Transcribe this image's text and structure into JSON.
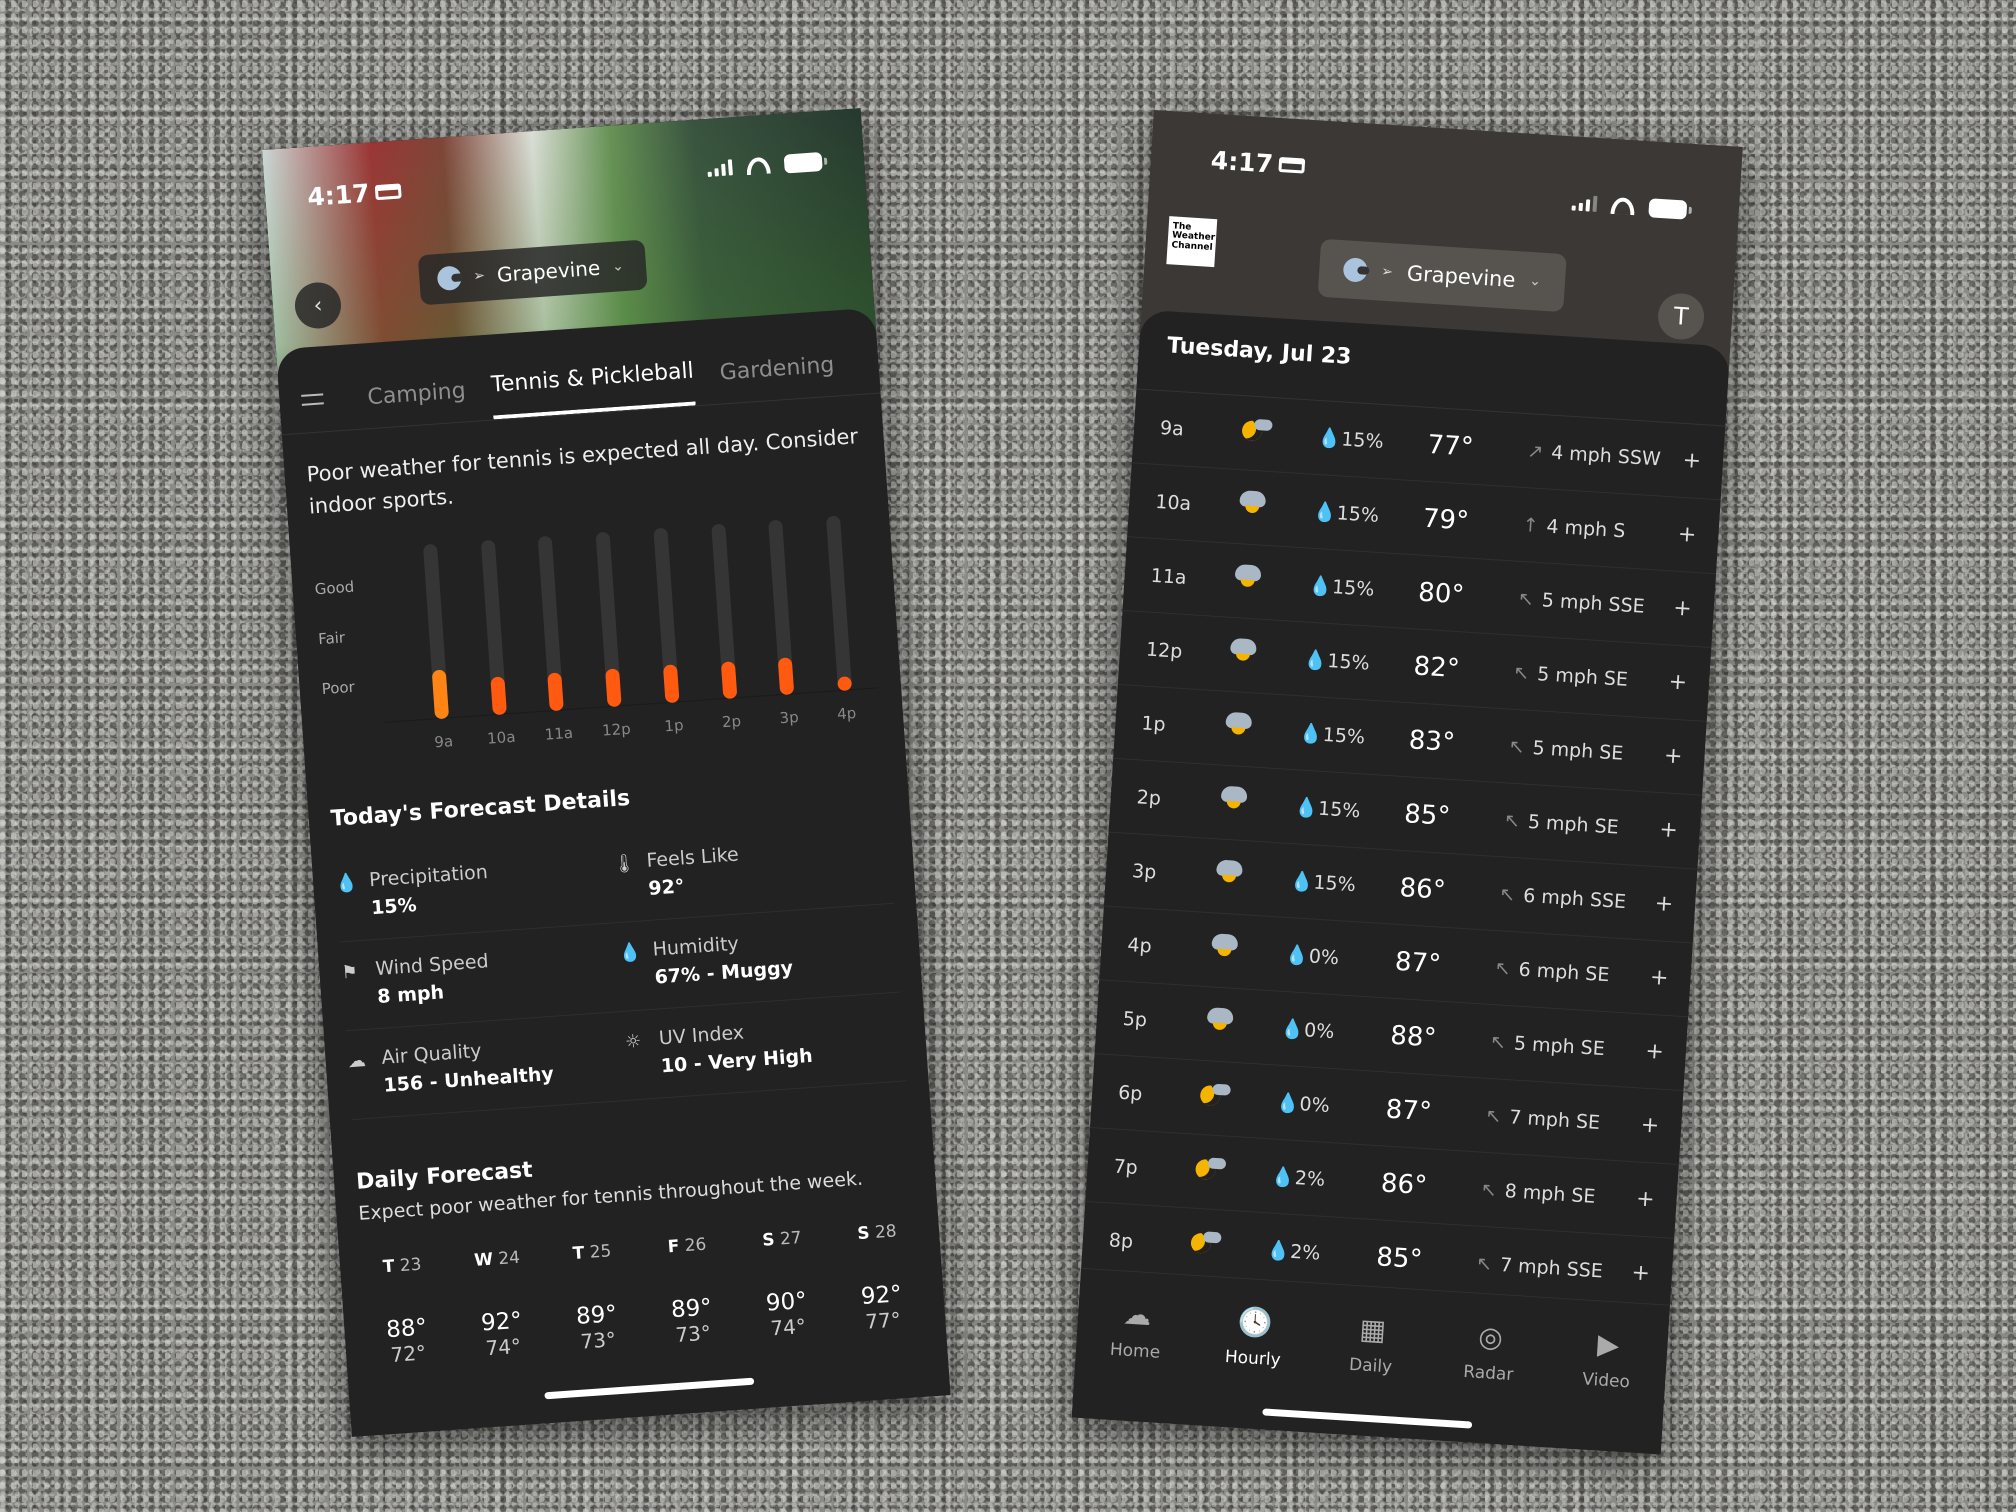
{
  "status_bar": {
    "time": "4:17"
  },
  "left_phone": {
    "location": "Grapevine",
    "tabs": [
      {
        "label": "Camping",
        "active": false
      },
      {
        "label": "Tennis & Pickleball",
        "active": true
      },
      {
        "label": "Gardening",
        "active": false
      }
    ],
    "summary": "Poor weather for tennis is expected all day. Consider indoor sports.",
    "activity_chart": {
      "y_levels": [
        "Good",
        "Fair",
        "Poor"
      ],
      "hours": [
        "9a",
        "10a",
        "11a",
        "12p",
        "1p",
        "2p",
        "3p",
        "4p"
      ],
      "scores": [
        0.28,
        0.22,
        0.22,
        0.22,
        0.22,
        0.21,
        0.21,
        0.05
      ],
      "fill_color": "#ff5a10"
    },
    "details_title": "Today's Forecast Details",
    "details": [
      {
        "icon": "droplet-icon",
        "glyph": "💧",
        "label": "Precipitation",
        "value": "15%"
      },
      {
        "icon": "thermometer-person-icon",
        "glyph": "🌡",
        "label": "Feels Like",
        "value": "92°"
      },
      {
        "icon": "wind-flag-icon",
        "glyph": "⚑",
        "label": "Wind Speed",
        "value": "8 mph"
      },
      {
        "icon": "humidity-drop-icon",
        "glyph": "💧",
        "label": "Humidity",
        "value": "67% - Muggy"
      },
      {
        "icon": "air-quality-icon",
        "glyph": "☁",
        "label": "Air Quality",
        "value": "156 - Unhealthy"
      },
      {
        "icon": "uv-sun-icon",
        "glyph": "☼",
        "label": "UV Index",
        "value": "10 - Very High"
      }
    ],
    "daily_title": "Daily Forecast",
    "daily_subtitle": "Expect poor weather for tennis throughout the week.",
    "daily": [
      {
        "dow": "T",
        "date": "23",
        "hi": "88°",
        "lo": "72°"
      },
      {
        "dow": "W",
        "date": "24",
        "hi": "92°",
        "lo": "74°"
      },
      {
        "dow": "T",
        "date": "25",
        "hi": "89°",
        "lo": "73°"
      },
      {
        "dow": "F",
        "date": "26",
        "hi": "89°",
        "lo": "73°"
      },
      {
        "dow": "S",
        "date": "27",
        "hi": "90°",
        "lo": "74°"
      },
      {
        "dow": "S",
        "date": "28",
        "hi": "92°",
        "lo": "77°"
      }
    ]
  },
  "right_phone": {
    "brand": "The Weather Channel",
    "location": "Grapevine",
    "avatar_initial": "T",
    "date_heading": "Tuesday, Jul 23",
    "hours": [
      {
        "time": "9a",
        "icon": "partly-cloudy-night",
        "precip": "15%",
        "temp": "77°",
        "wind_arrow": "↗",
        "wind": "4 mph SSW"
      },
      {
        "time": "10a",
        "icon": "mostly-cloudy",
        "precip": "15%",
        "temp": "79°",
        "wind_arrow": "↑",
        "wind": "4 mph S"
      },
      {
        "time": "11a",
        "icon": "mostly-cloudy",
        "precip": "15%",
        "temp": "80°",
        "wind_arrow": "↖",
        "wind": "5 mph SSE"
      },
      {
        "time": "12p",
        "icon": "mostly-cloudy",
        "precip": "15%",
        "temp": "82°",
        "wind_arrow": "↖",
        "wind": "5 mph SE"
      },
      {
        "time": "1p",
        "icon": "mostly-cloudy",
        "precip": "15%",
        "temp": "83°",
        "wind_arrow": "↖",
        "wind": "5 mph SE"
      },
      {
        "time": "2p",
        "icon": "mostly-cloudy",
        "precip": "15%",
        "temp": "85°",
        "wind_arrow": "↖",
        "wind": "5 mph SE"
      },
      {
        "time": "3p",
        "icon": "mostly-cloudy",
        "precip": "15%",
        "temp": "86°",
        "wind_arrow": "↖",
        "wind": "6 mph SSE"
      },
      {
        "time": "4p",
        "icon": "mostly-cloudy",
        "precip": "0%",
        "temp": "87°",
        "wind_arrow": "↖",
        "wind": "6 mph SE"
      },
      {
        "time": "5p",
        "icon": "mostly-cloudy",
        "precip": "0%",
        "temp": "88°",
        "wind_arrow": "↖",
        "wind": "5 mph SE"
      },
      {
        "time": "6p",
        "icon": "partly-cloudy-night",
        "precip": "0%",
        "temp": "87°",
        "wind_arrow": "↖",
        "wind": "7 mph SE"
      },
      {
        "time": "7p",
        "icon": "partly-cloudy-night",
        "precip": "2%",
        "temp": "86°",
        "wind_arrow": "↖",
        "wind": "8 mph SE"
      },
      {
        "time": "8p",
        "icon": "partly-cloudy-night",
        "precip": "2%",
        "temp": "85°",
        "wind_arrow": "↖",
        "wind": "7 mph SSE"
      }
    ],
    "tabbar": [
      {
        "label": "Home",
        "icon": "cloud-icon",
        "glyph": "☁",
        "active": false
      },
      {
        "label": "Hourly",
        "icon": "clock-icon",
        "glyph": "🕓",
        "active": true
      },
      {
        "label": "Daily",
        "icon": "calendar-icon",
        "glyph": "▦",
        "active": false
      },
      {
        "label": "Radar",
        "icon": "radar-icon",
        "glyph": "◎",
        "active": false
      },
      {
        "label": "Video",
        "icon": "video-icon",
        "glyph": "▶",
        "active": false
      }
    ]
  }
}
